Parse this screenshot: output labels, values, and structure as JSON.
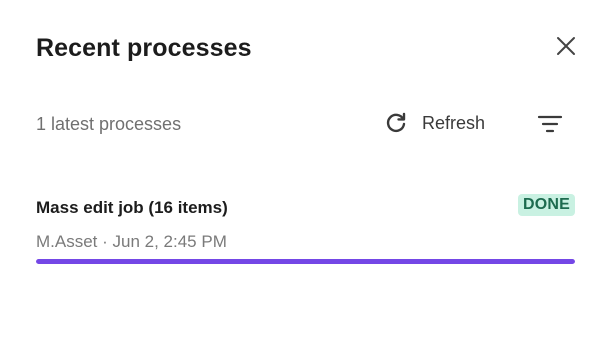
{
  "header": {
    "title": "Recent processes",
    "close_icon": "close-icon"
  },
  "toolbar": {
    "summary": "1 latest processes",
    "refresh_label": "Refresh",
    "refresh_icon": "refresh-icon",
    "filter_icon": "filter-icon"
  },
  "processes": [
    {
      "name": "Mass edit job (16 items)",
      "status": "DONE",
      "meta": "M.Asset · Jun 2, 2:45 PM",
      "progress": 1.0
    }
  ],
  "colors": {
    "accent": "#7447e6",
    "done_bg": "#c9f1e2",
    "done_text": "#1d6b4f"
  }
}
